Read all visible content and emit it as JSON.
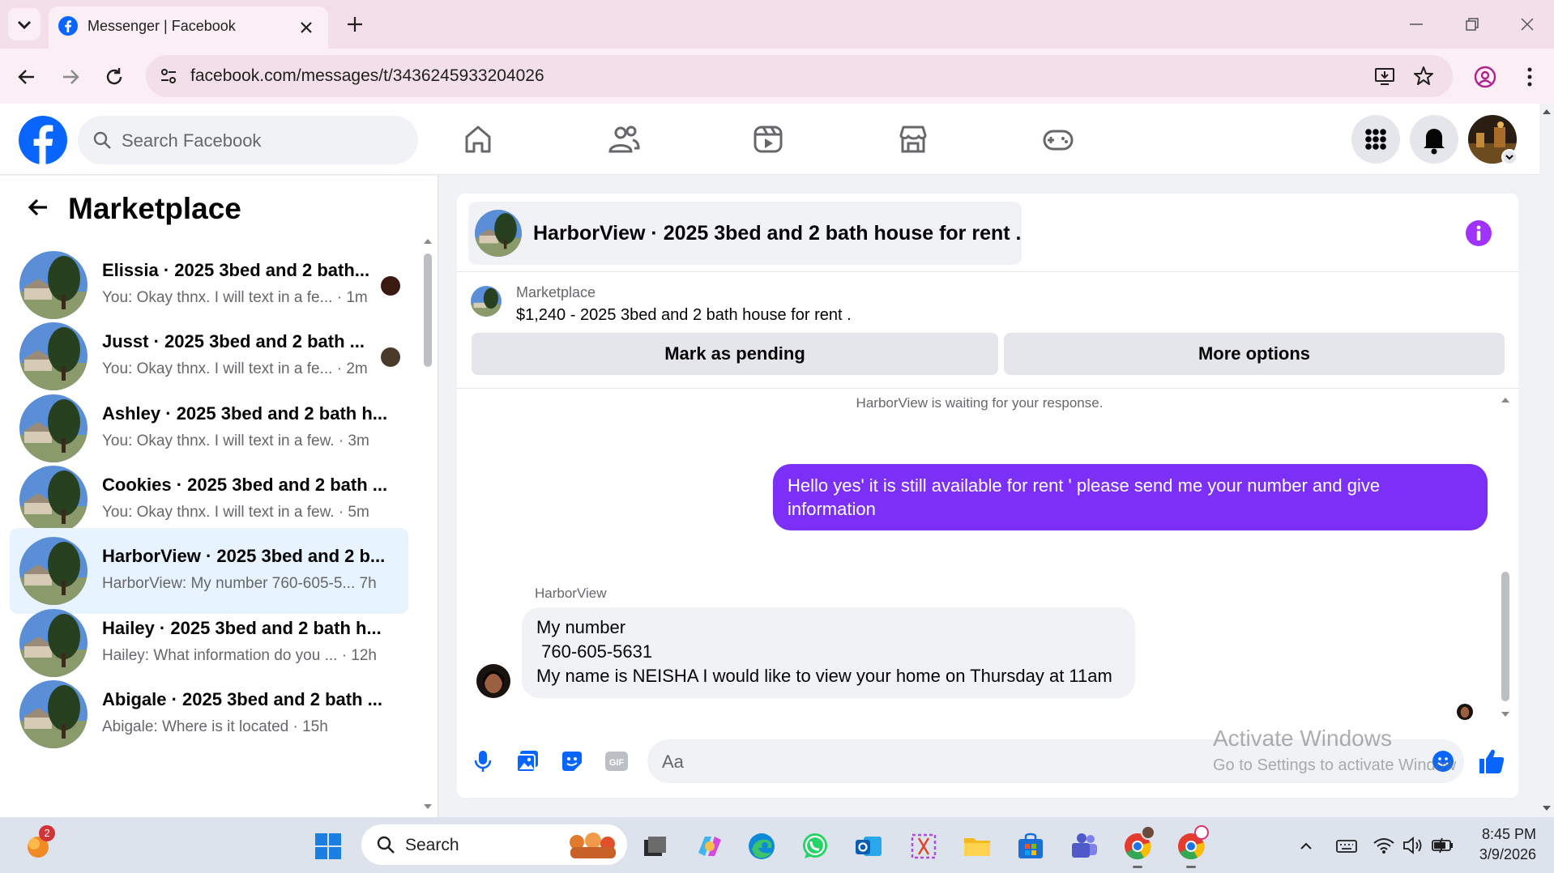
{
  "browser": {
    "tab_title": "Messenger | Facebook",
    "url": "facebook.com/messages/t/3436245933204026"
  },
  "facebook": {
    "search_placeholder": "Search Facebook"
  },
  "left_panel": {
    "title": "Marketplace",
    "conversations": [
      {
        "name": "Elissia · 2025 3bed and 2 bath...",
        "preview": "You: Okay thnx. I will text in a fe... · 1m"
      },
      {
        "name": "Jusst · 2025 3bed and 2 bath ...",
        "preview": "You: Okay thnx. I will text in a fe... · 2m"
      },
      {
        "name": "Ashley · 2025 3bed and 2 bath h...",
        "preview": "You: Okay thnx. I will text in a few. · 3m"
      },
      {
        "name": "Cookies · 2025 3bed and 2 bath ...",
        "preview": "You: Okay thnx. I will text in a few. · 5m"
      },
      {
        "name": "HarborView · 2025 3bed and 2 b...",
        "preview": "HarborView: My number 760-605-5... 7h"
      },
      {
        "name": "Hailey · 2025 3bed and 2 bath h...",
        "preview": "Hailey: What information do you ... · 12h"
      },
      {
        "name": "Abigale · 2025 3bed and 2 bath ...",
        "preview": "Abigale: Where is it located · 15h"
      }
    ]
  },
  "chat": {
    "header_title": "HarborView · 2025 3bed and 2 bath house for rent .",
    "listing_source": "Marketplace",
    "listing_title": "$1,240 - 2025 3bed and 2 bath house for rent .",
    "mark_pending_label": "Mark as pending",
    "more_options_label": "More options",
    "waiting_notice": "HarborView is waiting for your response.",
    "outgoing_message": "Hello yes' it is still available for rent ' please send me your number and give information",
    "incoming_sender": "HarborView",
    "incoming_lines": [
      "My number",
      " 760-605-5631",
      "My name is NEISHA I would like to view your home on Thursday at 11am"
    ],
    "composer_placeholder": "Aa"
  },
  "watermark": {
    "title": "Activate Windows",
    "subtitle": "Go to Settings to activate Windows."
  },
  "taskbar": {
    "search_label": "Search",
    "notification_badge": "2",
    "time": "8:45 PM",
    "date": "3/9/2026"
  },
  "colors": {
    "facebook_blue": "#0866ff",
    "outgoing_bubble": "#7b2ff7",
    "active_conversation": "#e7f3ff",
    "info_icon": "#a033ff"
  }
}
